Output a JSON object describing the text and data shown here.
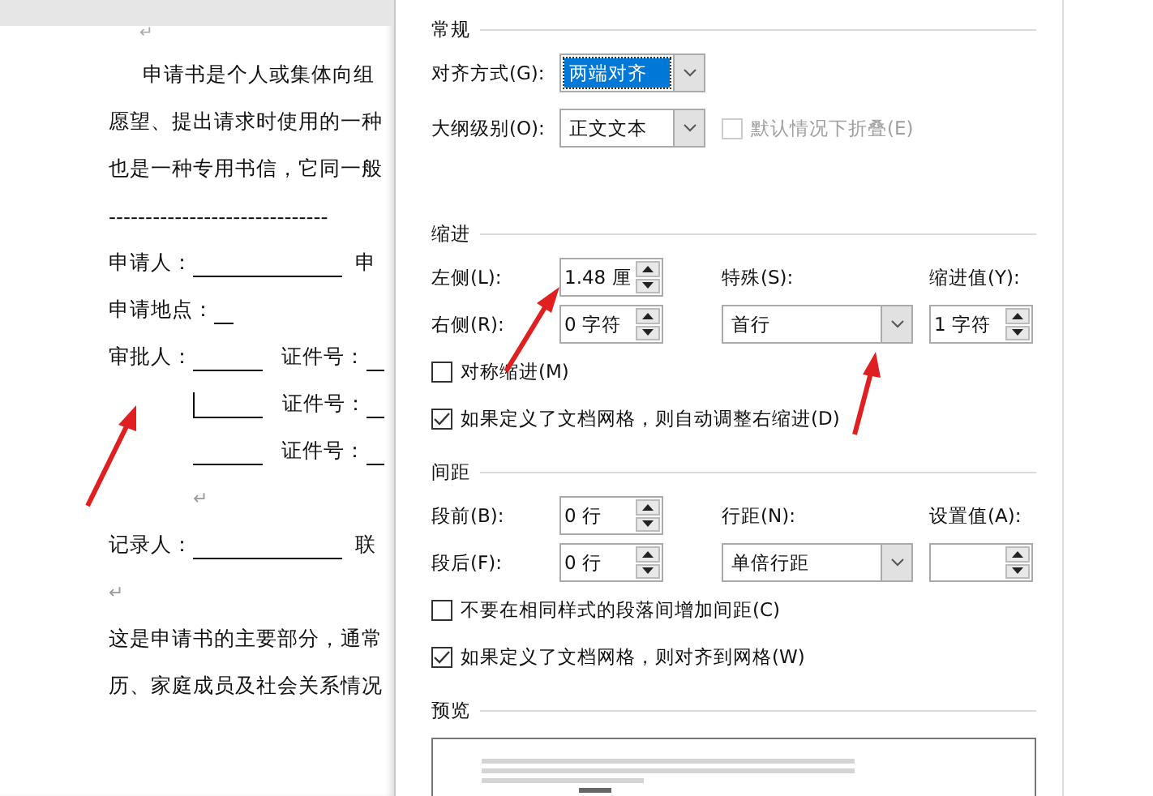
{
  "document": {
    "top_mark": "↵",
    "lines": [
      {
        "kind": "first",
        "segments": [
          {
            "kind": "text",
            "text": "申请书是个人或集体向组"
          }
        ]
      },
      {
        "kind": "plain",
        "segments": [
          {
            "kind": "text",
            "text": "愿望、提出请求时使用的一种"
          }
        ]
      },
      {
        "kind": "plain",
        "segments": [
          {
            "kind": "text",
            "text": "也是一种专用书信，它同一般"
          }
        ]
      },
      {
        "kind": "plain",
        "segments": [
          {
            "kind": "text",
            "text": "------------------------------"
          }
        ]
      },
      {
        "kind": "plain",
        "segments": [
          {
            "kind": "text",
            "text": "申请人："
          },
          {
            "kind": "longblank"
          },
          {
            "kind": "text",
            "text": "申"
          }
        ]
      },
      {
        "kind": "plain",
        "segments": [
          {
            "kind": "text",
            "text": "申请地点："
          },
          {
            "kind": "openblank"
          }
        ]
      },
      {
        "kind": "plain",
        "segments": [
          {
            "kind": "text",
            "text": "审批人："
          },
          {
            "kind": "blank"
          },
          {
            "kind": "text",
            "text": "证件号："
          },
          {
            "kind": "openblank"
          }
        ]
      },
      {
        "kind": "hanging",
        "segments": [
          {
            "kind": "cursor"
          },
          {
            "kind": "blank"
          },
          {
            "kind": "text",
            "text": "证件号："
          },
          {
            "kind": "openblank"
          }
        ]
      },
      {
        "kind": "hanging",
        "segments": [
          {
            "kind": "blank"
          },
          {
            "kind": "text",
            "text": "证件号："
          },
          {
            "kind": "openblank"
          }
        ]
      },
      {
        "kind": "hanging",
        "segments": [
          {
            "kind": "mark",
            "text": "↵"
          }
        ]
      },
      {
        "kind": "plain",
        "segments": [
          {
            "kind": "text",
            "text": "记录人："
          },
          {
            "kind": "longblank"
          },
          {
            "kind": "text",
            "text": "联"
          }
        ]
      },
      {
        "kind": "plain",
        "segments": [
          {
            "kind": "mark",
            "text": "↵"
          }
        ]
      },
      {
        "kind": "plain",
        "segments": [
          {
            "kind": "text",
            "text": "这是申请书的主要部分，通常"
          }
        ]
      },
      {
        "kind": "plain",
        "segments": [
          {
            "kind": "text",
            "text": "历、家庭成员及社会关系情况"
          }
        ]
      }
    ]
  },
  "dialog": {
    "sections": [
      {
        "kind": "fields",
        "title": "常规",
        "rows": [
          {
            "items": [
              {
                "kind": "label",
                "text": "对齐方式(G):"
              },
              {
                "kind": "dropdown",
                "value": "两端对齐",
                "selected": true
              }
            ]
          },
          {
            "items": [
              {
                "kind": "label",
                "text": "大纲级别(O):"
              },
              {
                "kind": "dropdown",
                "value": "正文文本",
                "selected": false
              },
              {
                "kind": "checkbox",
                "text": "默认情况下折叠(E)",
                "checked": false,
                "disabled": true
              }
            ]
          }
        ]
      },
      {
        "kind": "fields",
        "title": "缩进",
        "rows": [
          {
            "items": [
              {
                "kind": "label",
                "text": "左侧(L):"
              },
              {
                "kind": "spinner",
                "value": "1.48 厘"
              },
              {
                "kind": "label",
                "text": "特殊(S):"
              },
              {
                "kind": "label",
                "text": "缩进值(Y):"
              }
            ]
          },
          {
            "items": [
              {
                "kind": "label",
                "text": "右侧(R):"
              },
              {
                "kind": "spinner",
                "value": "0 字符"
              },
              {
                "kind": "dropdown",
                "value": "首行",
                "selected": false
              },
              {
                "kind": "spinner",
                "value": "1 字符"
              }
            ]
          },
          {
            "items": [
              {
                "kind": "checkbox",
                "text": "对称缩进(M)",
                "checked": false,
                "disabled": false
              }
            ]
          },
          {
            "items": [
              {
                "kind": "checkbox",
                "text": "如果定义了文档网格，则自动调整右缩进(D)",
                "checked": true,
                "disabled": false
              }
            ]
          }
        ]
      },
      {
        "kind": "fields",
        "title": "间距",
        "rows": [
          {
            "items": [
              {
                "kind": "label",
                "text": "段前(B):"
              },
              {
                "kind": "spinner",
                "value": "0 行"
              },
              {
                "kind": "label",
                "text": "行距(N):"
              },
              {
                "kind": "label",
                "text": "设置值(A):"
              }
            ]
          },
          {
            "items": [
              {
                "kind": "label",
                "text": "段后(F):"
              },
              {
                "kind": "spinner",
                "value": "0 行"
              },
              {
                "kind": "dropdown",
                "value": "单倍行距",
                "selected": false
              },
              {
                "kind": "spinner"
              }
            ]
          },
          {
            "items": [
              {
                "kind": "checkbox",
                "text": "不要在相同样式的段落间增加间距(C)",
                "checked": false,
                "disabled": false
              }
            ]
          },
          {
            "items": [
              {
                "kind": "checkbox",
                "text": "如果定义了文档网格，则对齐到网格(W)",
                "checked": true,
                "disabled": false
              }
            ]
          }
        ]
      },
      {
        "kind": "preview",
        "title": "预览"
      }
    ]
  }
}
